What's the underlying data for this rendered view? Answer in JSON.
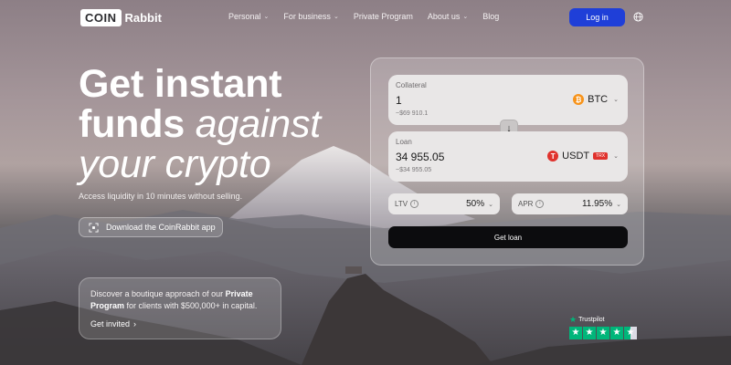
{
  "header": {
    "logo_box": "COIN",
    "logo_text": "Rabbit",
    "nav": [
      {
        "label": "Personal",
        "dropdown": true
      },
      {
        "label": "For business",
        "dropdown": true
      },
      {
        "label": "Private Program",
        "dropdown": false
      },
      {
        "label": "About us",
        "dropdown": true
      },
      {
        "label": "Blog",
        "dropdown": false
      }
    ],
    "login_label": "Log in",
    "language_icon": "globe-icon"
  },
  "hero": {
    "title_line1": "Get instant",
    "title_line2_bold": "funds ",
    "title_line2_italic": "against",
    "title_line3_italic": "your crypto",
    "subtitle": "Access liquidity in 10 minutes without selling.",
    "app_button_label": "Download the CoinRabbit app"
  },
  "private_program": {
    "text_before": "Discover a boutique approach of our ",
    "text_bold": "Private Program",
    "text_after": " for clients with $500,000+ in capital.",
    "link_label": "Get invited",
    "link_chevron": "›"
  },
  "calculator": {
    "collateral": {
      "label": "Collateral",
      "value": "1",
      "usd": "~$69 910.1",
      "currency": "BTC",
      "icon": "bitcoin-icon"
    },
    "swap_icon": "↓",
    "loan": {
      "label": "Loan",
      "value": "34 955.05",
      "usd": "~$34 955.05",
      "currency": "USDT",
      "network": "TRX",
      "icon": "tether-icon"
    },
    "ltv": {
      "label": "LTV",
      "value": "50%"
    },
    "apr": {
      "label": "APR",
      "value": "11.95%"
    },
    "submit_label": "Get loan"
  },
  "trustpilot": {
    "brand": "Trustpilot",
    "rating_stars": 4.5
  },
  "colors": {
    "accent": "#1f3fd8",
    "trustpilot_green": "#00b67a",
    "btc_orange": "#f7931a",
    "tron_red": "#e0322d"
  }
}
